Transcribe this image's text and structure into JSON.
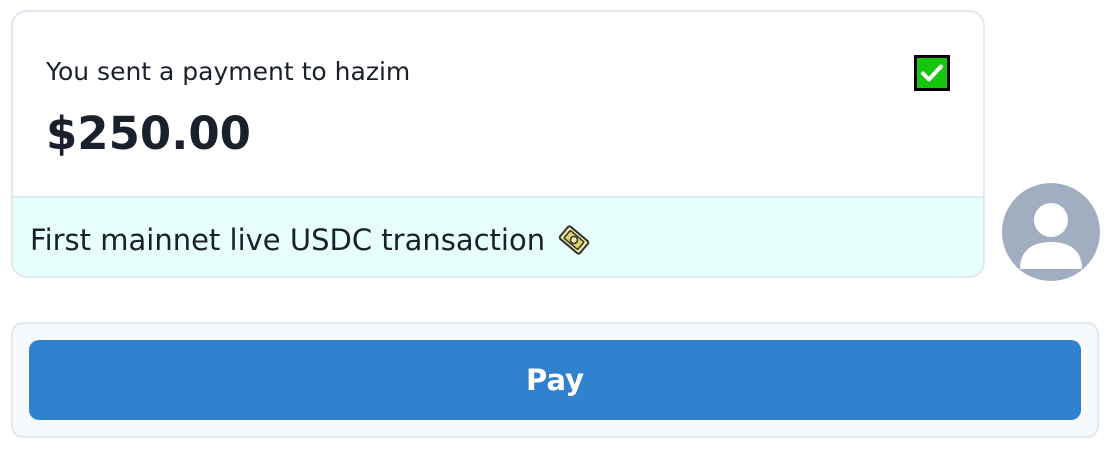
{
  "payment": {
    "sent_text": "You sent a payment to hazim",
    "amount": "$250.00",
    "status_icon": "check-mark-button-icon",
    "memo": "First mainnet live USDC transaction",
    "memo_icon": "coin-icon"
  },
  "avatar": {
    "icon": "user-avatar-icon"
  },
  "actions": {
    "pay_label": "Pay"
  },
  "colors": {
    "accent": "#3182ce",
    "memo_background": "#e6fffa",
    "border": "#e2e8f0",
    "avatar": "#a0aec0",
    "check_green": "#16c60c"
  }
}
